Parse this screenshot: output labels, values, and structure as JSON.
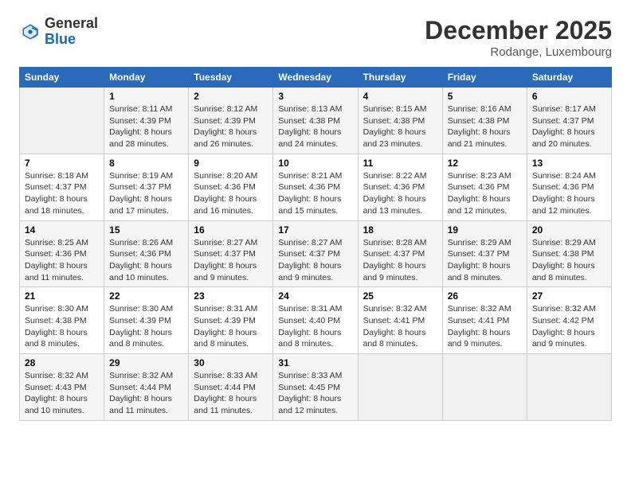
{
  "logo": {
    "general": "General",
    "blue": "Blue"
  },
  "header": {
    "month": "December 2025",
    "location": "Rodange, Luxembourg"
  },
  "weekdays": [
    "Sunday",
    "Monday",
    "Tuesday",
    "Wednesday",
    "Thursday",
    "Friday",
    "Saturday"
  ],
  "weeks": [
    [
      {
        "day": "",
        "sunrise": "",
        "sunset": "",
        "daylight": ""
      },
      {
        "day": "1",
        "sunrise": "Sunrise: 8:11 AM",
        "sunset": "Sunset: 4:39 PM",
        "daylight": "Daylight: 8 hours and 28 minutes."
      },
      {
        "day": "2",
        "sunrise": "Sunrise: 8:12 AM",
        "sunset": "Sunset: 4:39 PM",
        "daylight": "Daylight: 8 hours and 26 minutes."
      },
      {
        "day": "3",
        "sunrise": "Sunrise: 8:13 AM",
        "sunset": "Sunset: 4:38 PM",
        "daylight": "Daylight: 8 hours and 24 minutes."
      },
      {
        "day": "4",
        "sunrise": "Sunrise: 8:15 AM",
        "sunset": "Sunset: 4:38 PM",
        "daylight": "Daylight: 8 hours and 23 minutes."
      },
      {
        "day": "5",
        "sunrise": "Sunrise: 8:16 AM",
        "sunset": "Sunset: 4:38 PM",
        "daylight": "Daylight: 8 hours and 21 minutes."
      },
      {
        "day": "6",
        "sunrise": "Sunrise: 8:17 AM",
        "sunset": "Sunset: 4:37 PM",
        "daylight": "Daylight: 8 hours and 20 minutes."
      }
    ],
    [
      {
        "day": "7",
        "sunrise": "Sunrise: 8:18 AM",
        "sunset": "Sunset: 4:37 PM",
        "daylight": "Daylight: 8 hours and 18 minutes."
      },
      {
        "day": "8",
        "sunrise": "Sunrise: 8:19 AM",
        "sunset": "Sunset: 4:37 PM",
        "daylight": "Daylight: 8 hours and 17 minutes."
      },
      {
        "day": "9",
        "sunrise": "Sunrise: 8:20 AM",
        "sunset": "Sunset: 4:36 PM",
        "daylight": "Daylight: 8 hours and 16 minutes."
      },
      {
        "day": "10",
        "sunrise": "Sunrise: 8:21 AM",
        "sunset": "Sunset: 4:36 PM",
        "daylight": "Daylight: 8 hours and 15 minutes."
      },
      {
        "day": "11",
        "sunrise": "Sunrise: 8:22 AM",
        "sunset": "Sunset: 4:36 PM",
        "daylight": "Daylight: 8 hours and 13 minutes."
      },
      {
        "day": "12",
        "sunrise": "Sunrise: 8:23 AM",
        "sunset": "Sunset: 4:36 PM",
        "daylight": "Daylight: 8 hours and 12 minutes."
      },
      {
        "day": "13",
        "sunrise": "Sunrise: 8:24 AM",
        "sunset": "Sunset: 4:36 PM",
        "daylight": "Daylight: 8 hours and 12 minutes."
      }
    ],
    [
      {
        "day": "14",
        "sunrise": "Sunrise: 8:25 AM",
        "sunset": "Sunset: 4:36 PM",
        "daylight": "Daylight: 8 hours and 11 minutes."
      },
      {
        "day": "15",
        "sunrise": "Sunrise: 8:26 AM",
        "sunset": "Sunset: 4:36 PM",
        "daylight": "Daylight: 8 hours and 10 minutes."
      },
      {
        "day": "16",
        "sunrise": "Sunrise: 8:27 AM",
        "sunset": "Sunset: 4:37 PM",
        "daylight": "Daylight: 8 hours and 9 minutes."
      },
      {
        "day": "17",
        "sunrise": "Sunrise: 8:27 AM",
        "sunset": "Sunset: 4:37 PM",
        "daylight": "Daylight: 8 hours and 9 minutes."
      },
      {
        "day": "18",
        "sunrise": "Sunrise: 8:28 AM",
        "sunset": "Sunset: 4:37 PM",
        "daylight": "Daylight: 8 hours and 9 minutes."
      },
      {
        "day": "19",
        "sunrise": "Sunrise: 8:29 AM",
        "sunset": "Sunset: 4:37 PM",
        "daylight": "Daylight: 8 hours and 8 minutes."
      },
      {
        "day": "20",
        "sunrise": "Sunrise: 8:29 AM",
        "sunset": "Sunset: 4:38 PM",
        "daylight": "Daylight: 8 hours and 8 minutes."
      }
    ],
    [
      {
        "day": "21",
        "sunrise": "Sunrise: 8:30 AM",
        "sunset": "Sunset: 4:38 PM",
        "daylight": "Daylight: 8 hours and 8 minutes."
      },
      {
        "day": "22",
        "sunrise": "Sunrise: 8:30 AM",
        "sunset": "Sunset: 4:39 PM",
        "daylight": "Daylight: 8 hours and 8 minutes."
      },
      {
        "day": "23",
        "sunrise": "Sunrise: 8:31 AM",
        "sunset": "Sunset: 4:39 PM",
        "daylight": "Daylight: 8 hours and 8 minutes."
      },
      {
        "day": "24",
        "sunrise": "Sunrise: 8:31 AM",
        "sunset": "Sunset: 4:40 PM",
        "daylight": "Daylight: 8 hours and 8 minutes."
      },
      {
        "day": "25",
        "sunrise": "Sunrise: 8:32 AM",
        "sunset": "Sunset: 4:41 PM",
        "daylight": "Daylight: 8 hours and 8 minutes."
      },
      {
        "day": "26",
        "sunrise": "Sunrise: 8:32 AM",
        "sunset": "Sunset: 4:41 PM",
        "daylight": "Daylight: 8 hours and 9 minutes."
      },
      {
        "day": "27",
        "sunrise": "Sunrise: 8:32 AM",
        "sunset": "Sunset: 4:42 PM",
        "daylight": "Daylight: 8 hours and 9 minutes."
      }
    ],
    [
      {
        "day": "28",
        "sunrise": "Sunrise: 8:32 AM",
        "sunset": "Sunset: 4:43 PM",
        "daylight": "Daylight: 8 hours and 10 minutes."
      },
      {
        "day": "29",
        "sunrise": "Sunrise: 8:32 AM",
        "sunset": "Sunset: 4:44 PM",
        "daylight": "Daylight: 8 hours and 11 minutes."
      },
      {
        "day": "30",
        "sunrise": "Sunrise: 8:33 AM",
        "sunset": "Sunset: 4:44 PM",
        "daylight": "Daylight: 8 hours and 11 minutes."
      },
      {
        "day": "31",
        "sunrise": "Sunrise: 8:33 AM",
        "sunset": "Sunset: 4:45 PM",
        "daylight": "Daylight: 8 hours and 12 minutes."
      },
      {
        "day": "",
        "sunrise": "",
        "sunset": "",
        "daylight": ""
      },
      {
        "day": "",
        "sunrise": "",
        "sunset": "",
        "daylight": ""
      },
      {
        "day": "",
        "sunrise": "",
        "sunset": "",
        "daylight": ""
      }
    ]
  ]
}
